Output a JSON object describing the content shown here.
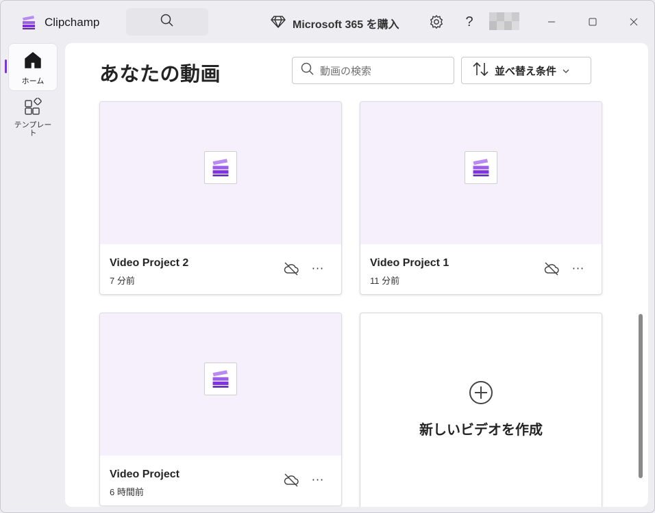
{
  "titlebar": {
    "app_name": "Clipchamp",
    "microsoft365_label": "Microsoft 365 を購入",
    "help_glyph": "?"
  },
  "rail": {
    "items": [
      {
        "label": "ホーム",
        "icon": "home-icon",
        "active": true
      },
      {
        "label": "テンプレート",
        "icon": "templates-icon",
        "active": false
      }
    ]
  },
  "main": {
    "title": "あなたの動画",
    "search": {
      "placeholder": "動画の検索"
    },
    "sort_label": "並べ替え条件",
    "projects": [
      {
        "title": "Video Project 2",
        "time": "7 分前"
      },
      {
        "title": "Video Project 1",
        "time": "11 分前"
      },
      {
        "title": "Video Project",
        "time": "6 時間前"
      }
    ],
    "create_label": "新しいビデオを作成",
    "more_glyph": "···"
  },
  "colors": {
    "accent": "#7f32e0",
    "thumbnail_bg": "#f6effc",
    "content_bg": "#ffffff",
    "window_bg": "#eeedf2"
  }
}
